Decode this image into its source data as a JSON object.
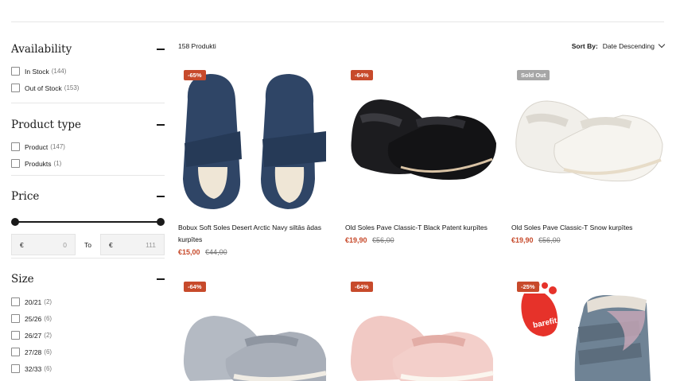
{
  "filters": {
    "availability": {
      "title": "Availability",
      "options": [
        {
          "label": "In Stock",
          "count": "(144)"
        },
        {
          "label": "Out of Stock",
          "count": "(153)"
        }
      ]
    },
    "product_type": {
      "title": "Product type",
      "options": [
        {
          "label": "Product",
          "count": "(147)"
        },
        {
          "label": "Produkts",
          "count": "(1)"
        }
      ]
    },
    "price": {
      "title": "Price",
      "currency": "€",
      "min_value": "0",
      "to_label": "To",
      "max_value": "111",
      "range_fraction": [
        0,
        1
      ]
    },
    "size": {
      "title": "Size",
      "options": [
        {
          "label": "20/21",
          "count": "(2)"
        },
        {
          "label": "25/26",
          "count": "(6)"
        },
        {
          "label": "26/27",
          "count": "(2)"
        },
        {
          "label": "27/28",
          "count": "(6)"
        },
        {
          "label": "32/33",
          "count": "(6)"
        }
      ]
    }
  },
  "toolbar": {
    "count_label": "158 Produkti",
    "sort_label": "Sort By:",
    "sort_value": "Date Descending"
  },
  "products": [
    {
      "badge": "-65%",
      "title": "Bobux Soft Soles Desert Arctic Navy siltās ādas kurpītes",
      "price": "€15,00",
      "old_price": "€44,00",
      "image": "navy-soft-sole-booties"
    },
    {
      "badge": "-64%",
      "title": "Old Soles Pave Classic-T Black Patent kurpītes",
      "price": "€19,90",
      "old_price": "€56,00",
      "image": "black-patent-t-bar-shoes"
    },
    {
      "badge": "Sold Out",
      "title": "Old Soles Pave Classic-T Snow kurpītes",
      "price": "€19,90",
      "old_price": "€56,00",
      "image": "white-t-bar-shoes"
    },
    {
      "badge": "-64%",
      "image": "grey-mary-jane-shoes"
    },
    {
      "badge": "-64%",
      "image": "pink-mary-jane-shoes"
    },
    {
      "badge": "-25%",
      "logo_text": "barefit",
      "image": "blue-floral-winter-boot"
    }
  ],
  "colors": {
    "accent": "#c74a2b",
    "sold_out": "#a6a6a6"
  }
}
